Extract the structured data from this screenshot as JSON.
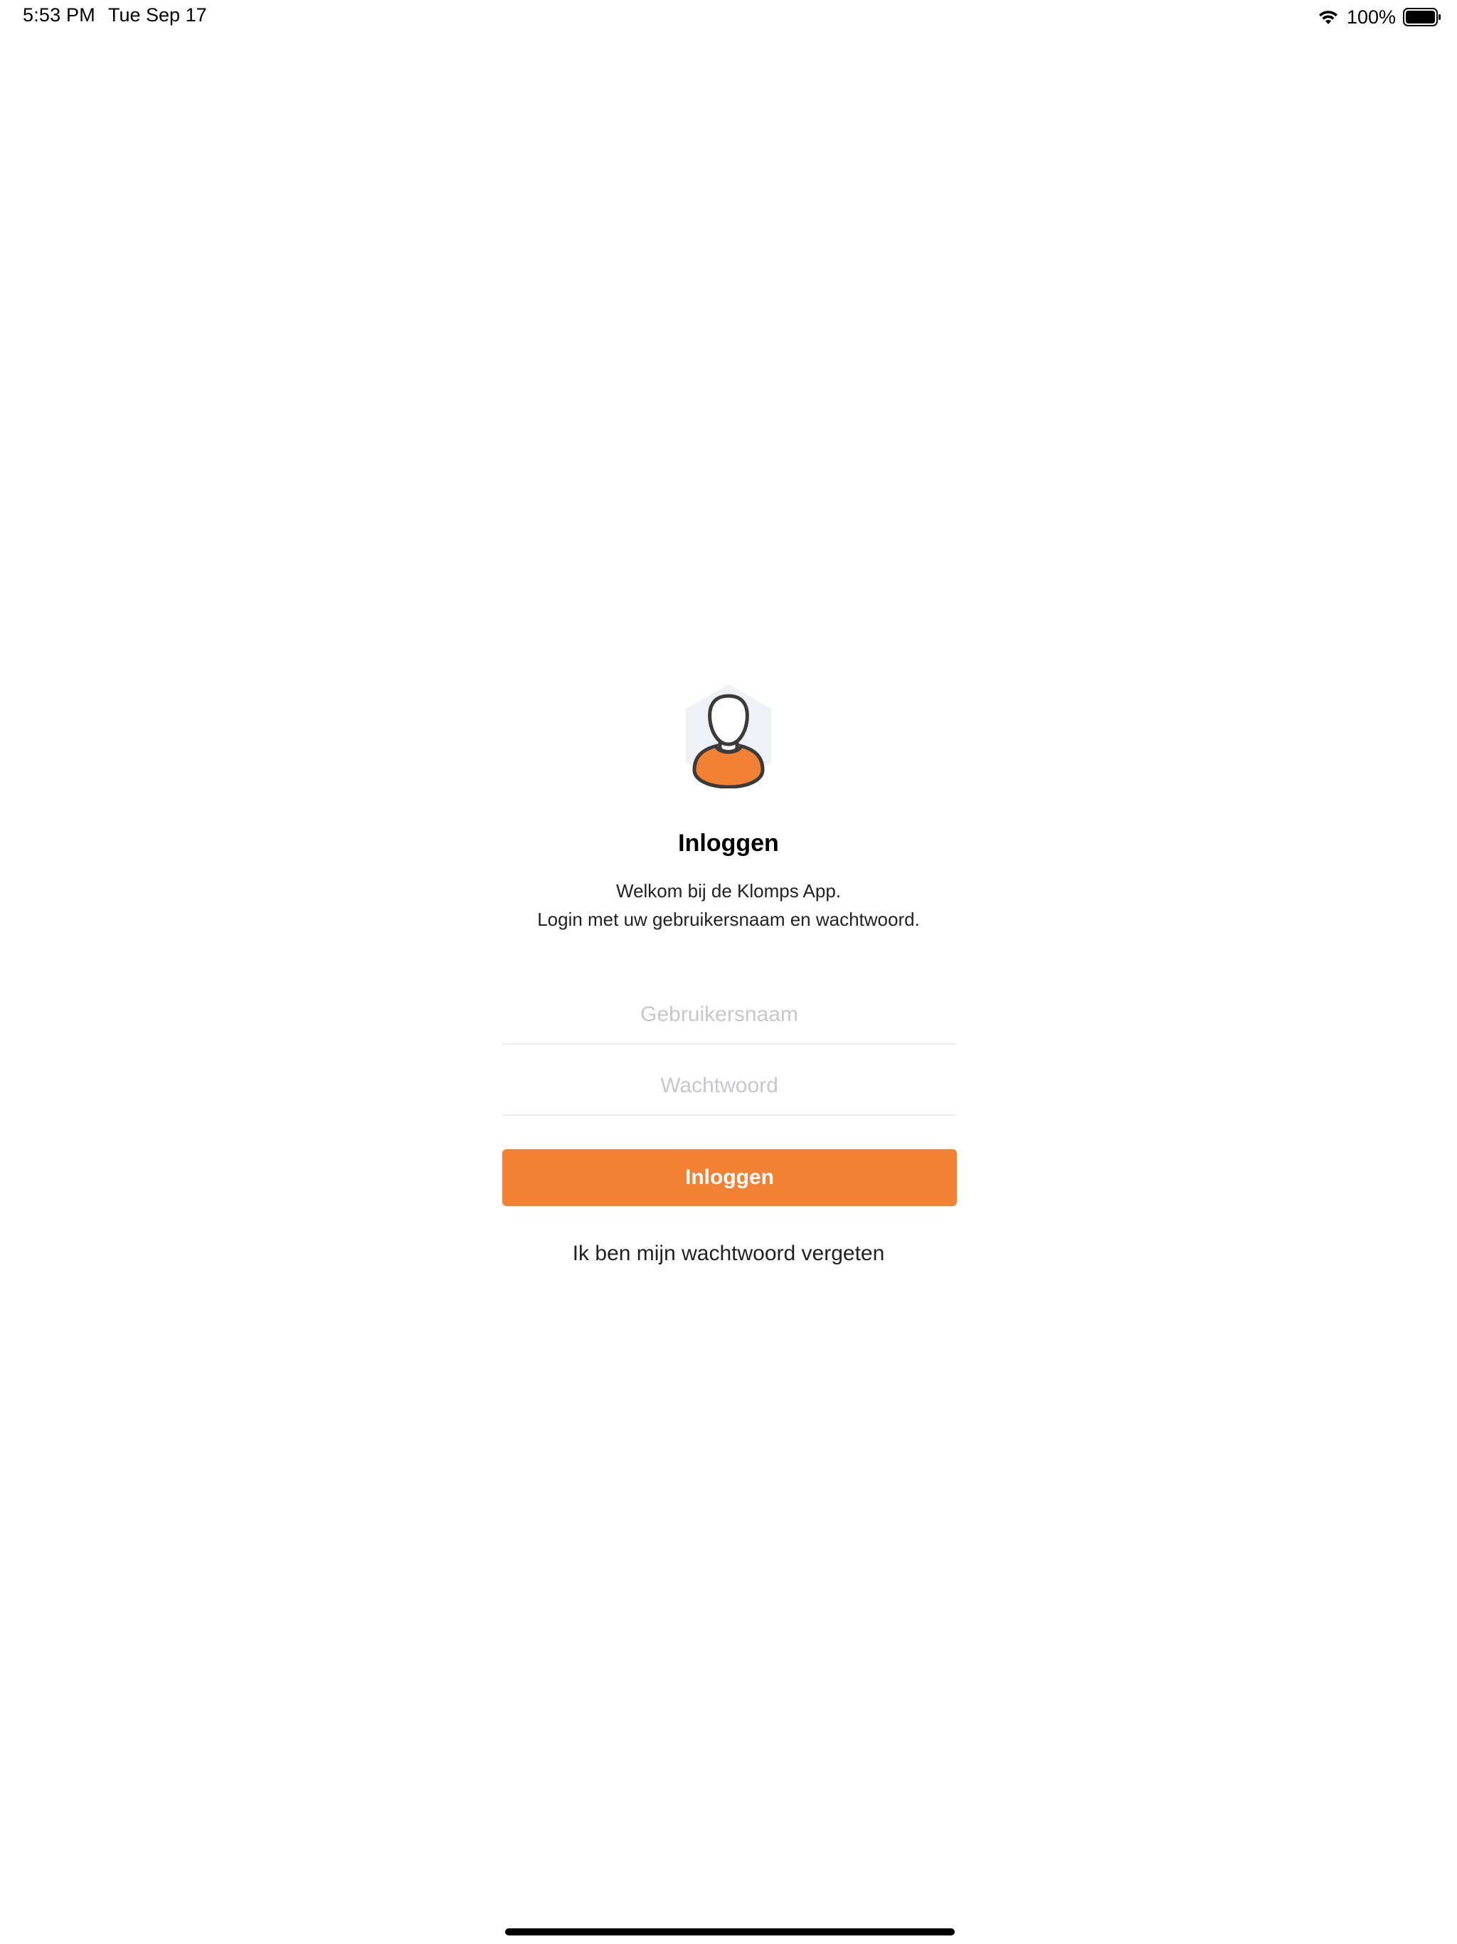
{
  "status_bar": {
    "time": "5:53 PM",
    "date": "Tue Sep 17",
    "battery_percent": "100%",
    "wifi_icon": "wifi-icon",
    "battery_icon": "battery-icon",
    "battery_level": 1.0
  },
  "login": {
    "avatar_icon": "user-avatar-icon",
    "title": "Inloggen",
    "welcome_line1": "Welkom bij de Klomps App.",
    "welcome_line2": "Login met uw gebruikersnaam en wachtwoord.",
    "username": {
      "value": "",
      "placeholder": "Gebruikersnaam"
    },
    "password": {
      "value": "",
      "placeholder": "Wachtwoord"
    },
    "submit_label": "Inloggen",
    "forgot_label": "Ik ben mijn wachtwoord vergeten"
  },
  "colors": {
    "accent": "#f28135",
    "placeholder": "#c7c7cc",
    "avatar_bg": "#eef2f7",
    "outline": "#3a3a3a"
  }
}
